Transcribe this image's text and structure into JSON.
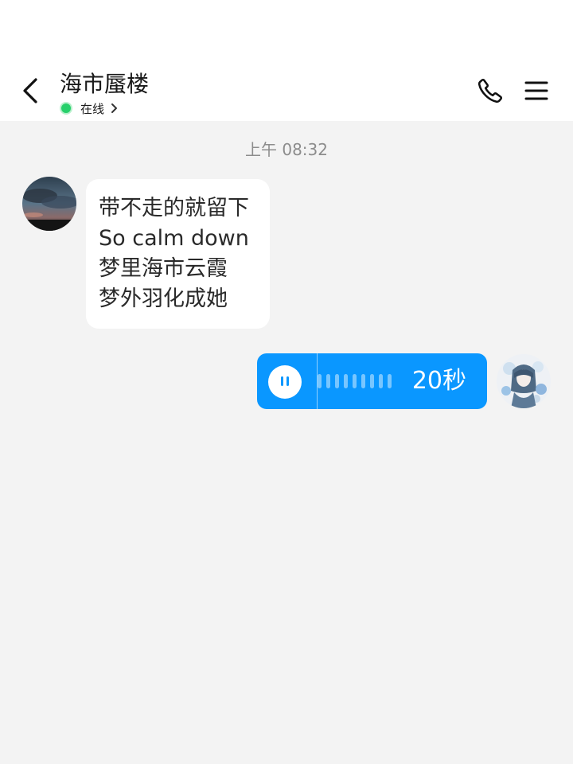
{
  "header": {
    "contact_name": "海市蜃楼",
    "status_text": "在线",
    "status_color": "#27d06b",
    "icons": [
      "chevron-left-icon",
      "phone-icon",
      "menu-icon",
      "chevron-right-icon"
    ]
  },
  "chat": {
    "timestamp": "上午 08:32",
    "messages": [
      {
        "side": "left",
        "type": "text",
        "lines": [
          "带不走的就留下",
          "So calm down",
          "梦里海市云霞",
          "梦外羽化成她"
        ]
      },
      {
        "side": "right",
        "type": "voice",
        "duration": "20秒",
        "state": "playing",
        "bubble_color": "#0a97ff"
      }
    ]
  },
  "colors": {
    "accent": "#0a97ff",
    "background": "#f3f3f3",
    "online": "#27d06b"
  }
}
